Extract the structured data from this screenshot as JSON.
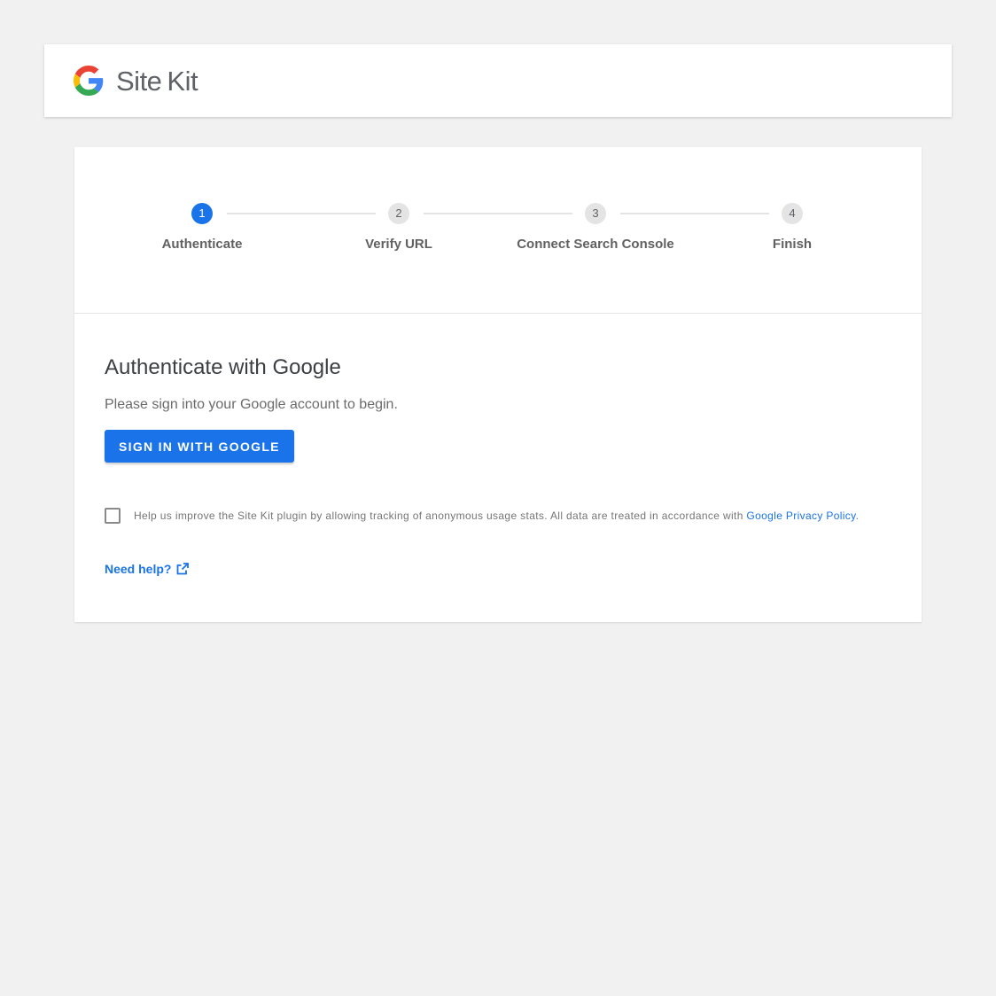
{
  "header": {
    "logo_site": "Site",
    "logo_kit": "Kit"
  },
  "stepper": {
    "steps": [
      {
        "number": "1",
        "label": "Authenticate",
        "active": true
      },
      {
        "number": "2",
        "label": "Verify URL",
        "active": false
      },
      {
        "number": "3",
        "label": "Connect Search Console",
        "active": false
      },
      {
        "number": "4",
        "label": "Finish",
        "active": false
      }
    ]
  },
  "main": {
    "title": "Authenticate with Google",
    "subtitle": "Please sign into your Google account to begin.",
    "signin_button": "Sign in with Google",
    "optin_text": "Help us improve the Site Kit plugin by allowing tracking of anonymous usage stats. All data are treated in accordance with ",
    "optin_link": "Google Privacy Policy",
    "optin_suffix": ".",
    "help_link": "Need help?"
  },
  "colors": {
    "accent": "#1a73e8",
    "background": "#f1f1f1"
  },
  "icons": {
    "logo": "google-g-icon",
    "help": "external-link-icon"
  }
}
